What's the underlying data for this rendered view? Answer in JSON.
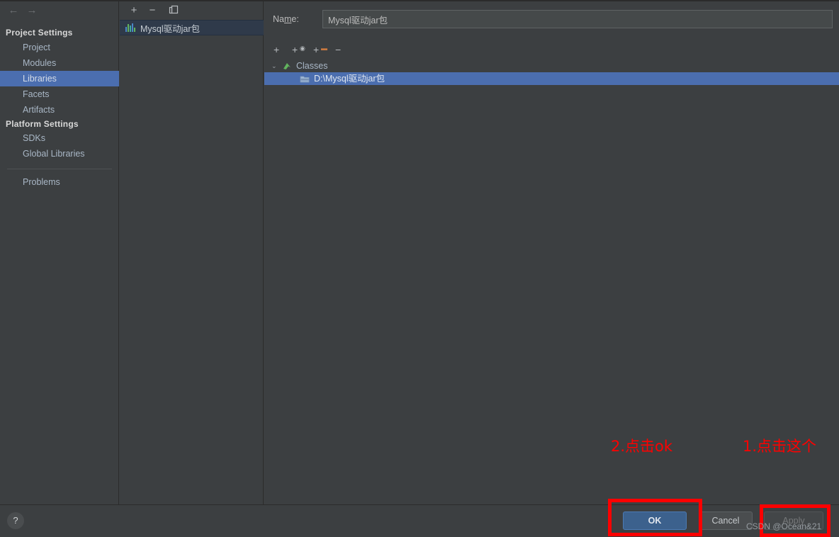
{
  "window": {
    "background_color": "#3c3f41",
    "accent_selection_color": "#4b6eaf"
  },
  "sidebar": {
    "nav": {
      "back_icon": "arrow-left-icon",
      "back_glyph": "←",
      "forward_icon": "arrow-right-icon",
      "forward_glyph": "→"
    },
    "groups": [
      {
        "label": "Project Settings",
        "items": [
          {
            "label": "Project",
            "selected": false
          },
          {
            "label": "Modules",
            "selected": false
          },
          {
            "label": "Libraries",
            "selected": true
          },
          {
            "label": "Facets",
            "selected": false
          },
          {
            "label": "Artifacts",
            "selected": false
          }
        ]
      },
      {
        "label": "Platform Settings",
        "items": [
          {
            "label": "SDKs",
            "selected": false
          },
          {
            "label": "Global Libraries",
            "selected": false
          }
        ]
      }
    ],
    "extra_items": [
      {
        "label": "Problems",
        "selected": false
      }
    ]
  },
  "library_list": {
    "toolbar": {
      "add_label": "+",
      "remove_label": "−",
      "copy_icon": "copy-icon"
    },
    "items": [
      {
        "label": "Mysql驱动jar包",
        "icon": "library-icon",
        "selected": true,
        "icon_bar_colors": [
          "#4a86c8",
          "#62b45e",
          "#3fa9a0",
          "#4a86c8",
          "#62b45e"
        ]
      }
    ]
  },
  "detail": {
    "name_label_prefix": "Na",
    "name_label_mnemonic": "m",
    "name_label_suffix": "e:",
    "name_value": "Mysql驱动jar包",
    "name_placeholder": "",
    "classes_toolbar": {
      "add_icon": "plus-icon",
      "add_label": "+",
      "attach_icon": "plus-circle-icon",
      "attach_label": "+",
      "add_folder_icon": "plus-folder-icon",
      "add_folder_label": "+",
      "remove_icon": "minus-icon",
      "remove_label": "−"
    },
    "tree": {
      "root": {
        "label": "Classes",
        "icon": "classes-arrow-icon",
        "expanded": true,
        "twisty_glyph": "⌄"
      },
      "children": [
        {
          "label": "D:\\Mysql驱动jar包",
          "icon": "jar-folder-icon",
          "selected": true
        }
      ]
    }
  },
  "bottom": {
    "help_label": "?",
    "help_icon": "help-icon",
    "buttons": [
      {
        "name": "ok",
        "label": "OK",
        "enabled": true,
        "primary": true
      },
      {
        "name": "cancel",
        "label": "Cancel",
        "enabled": true,
        "primary": false
      },
      {
        "name": "apply",
        "label": "Apply",
        "enabled": false,
        "primary": false
      }
    ]
  },
  "annotations": {
    "color": "#ff0000",
    "texts": [
      {
        "id": "step2",
        "label": "2.点击ok"
      },
      {
        "id": "step1",
        "label": "1.点击这个"
      }
    ],
    "boxes": [
      {
        "id": "ok-highlight",
        "target": "ok-button"
      },
      {
        "id": "apply-highlight",
        "target": "apply-button"
      }
    ]
  },
  "watermark": {
    "text": "CSDN @Ocean&21"
  }
}
